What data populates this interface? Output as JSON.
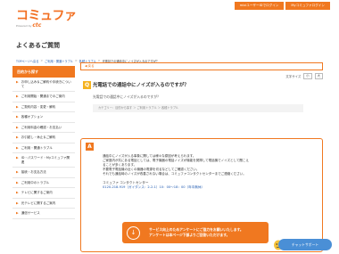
{
  "header": {
    "logo_text": "コミュファ",
    "logo_sub": "Powered by",
    "logo_brand": "ctc",
    "links": [
      "mixiユーザーIDでログイン",
      "Myコミュファログイン"
    ]
  },
  "page_title": "よくあるご質問",
  "breadcrumb": [
    "TOPページへ戻る",
    "ご利用・開通トラブル",
    "各種トラブル",
    "光電話での通話中にノイズが入るのですが？"
  ],
  "sidebar": {
    "heading": "目的から探す",
    "items": [
      "お申し込み＆ご解約や手続きについて",
      "ご利用開始・開通までのご案内",
      "ご契約内容・変更・解約",
      "各種オプション",
      "ご利用料金の確認・お支払い",
      "お引越し・休止＆ご解約",
      "ご利用・開通トラブル",
      "ID・パスワード・Myコミュファ関連",
      "接続・お支払方法",
      "ご利用中のトラブル",
      "テレビに関するご案内",
      "光テレビに関するご案内",
      "通信サービス"
    ]
  },
  "main": {
    "back_label": "◀ 戻る",
    "font_label": "文字サイズ",
    "font_small": "小",
    "font_large": "大",
    "question": {
      "badge": "Q",
      "title": "光電話での通話中にノイズが入るのですが？",
      "sub": "光電話での通話中にノイズが入るのですが？",
      "category": "カテゴリー：目的から探す ＞ ご利用トラブル ＞ 各種トラブル"
    },
    "answer": {
      "badge": "A",
      "lines": [
        "通話中にノイズが入る事象に関しては様々な原因が考えられます。",
        "ご家庭内が共にある電話としては、電子機器の電話ノイズが機能を発揮して電話機でノイズとして聞こえ",
        "ることが多くあります。",
        "不要電子電話機の近くの機器の電源を切るなどしてご確認ください。",
        "それでも通話時のノイズが改善されない場合は、コミュファコンタクトセンターまでご連絡ください。"
      ],
      "contact_title": "コミュファ コンタクトセンター",
      "contact_phone": "0120-218-919（ガイダンス：2-2-1）10：00〜18：00（年中無休）"
    },
    "survey": {
      "line1": "サービス向上のためアンケートにご協力をお願いいたします。",
      "line2": "アンケートは本ページ下部よりご回答いただけます。"
    }
  },
  "chat": {
    "label": "チャットサポート"
  }
}
